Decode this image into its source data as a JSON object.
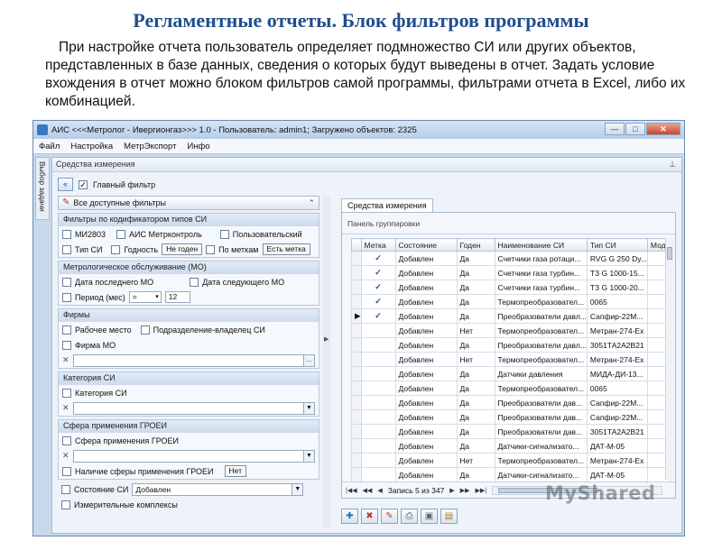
{
  "slide": {
    "title": "Регламентные отчеты. Блок фильтров программы",
    "paragraph": "При настройке отчета пользователь определяет подмножество СИ или других объектов, представленных в базе данных, сведения о которых будут выведены в отчет. Задать условие вхождения в отчет можно блоком фильтров самой программы, фильтрами отчета в Excel, либо их комбинацией."
  },
  "window": {
    "title": "АИС <<<Метролог - Ивергионгаз>>> 1.0 - Пользователь: admin1; Загружено объектов: 2325",
    "controls": {
      "minimize": "—",
      "maximize": "□",
      "close": "✕"
    }
  },
  "menu": [
    "Файл",
    "Настройка",
    "МетрЭкспорт",
    "Инфо"
  ],
  "side_tab": "Выбор задачи",
  "panel": {
    "header": "Средства измерения",
    "pin": "⊥"
  },
  "toolbar": {
    "main_filter_label": "Главный фильтр",
    "main_filter_checked": "✓"
  },
  "filters": {
    "all_label": "Все доступные фильтры",
    "codifier": {
      "header": "Фильтры по кодификатором типов СИ",
      "opt1": "МИ2803",
      "opt2": "АИС Метрконтроль",
      "opt3": "Пользовательский",
      "opt4": "Тип СИ",
      "opt5": "Годность",
      "btn_bad": "Не годен",
      "opt6": "По меткам",
      "btn_mark": "Есть метка"
    },
    "maintenance": {
      "header": "Метрологическое обслуживание (МО)",
      "last": "Дата последнего МО",
      "next": "Дата следующего МО",
      "period": "Период (мес)",
      "op": "=",
      "period_value": "12"
    },
    "firms": {
      "header": "Фирмы",
      "workplace": "Рабочее место",
      "division": "Подразделение-владелец СИ",
      "firm": "Фирма МО",
      "clear": "✕",
      "more": "..."
    },
    "category": {
      "header": "Категория СИ",
      "label": "Категория СИ",
      "clear": "✕"
    },
    "sphere": {
      "header": "Сфера применения ГРОЕИ",
      "label": "Сфера применения ГРОЕИ",
      "clear": "✕",
      "presence": "Наличие сферы применения ГРОЕИ",
      "presence_value": "Нет"
    },
    "state": {
      "label": "Состояние СИ",
      "value": "Добавлен"
    },
    "complex": {
      "label": "Измерительные комплексы"
    }
  },
  "grid": {
    "tab": "Средства измерения",
    "group_panel": "Панель группировки",
    "columns": [
      "Метка",
      "Состояние",
      "Годен",
      "Наименование СИ",
      "Тип СИ",
      "Моде"
    ],
    "rows": [
      {
        "m": "✓",
        "s": "Добавлен",
        "g": "Да",
        "n": "Счетчики газа ротаци...",
        "t": "RVG G 250 Dy..."
      },
      {
        "m": "✓",
        "s": "Добавлен",
        "g": "Да",
        "n": "Счетчики газа турбин...",
        "t": "ТЗ G 1000-15..."
      },
      {
        "m": "✓",
        "s": "Добавлен",
        "g": "Да",
        "n": "Счетчики газа турбин...",
        "t": "ТЗ G 1000-20..."
      },
      {
        "m": "✓",
        "s": "Добавлен",
        "g": "Да",
        "n": "Термопреобразовател...",
        "t": "0065"
      },
      {
        "m": "✓",
        "s": "Добавлен",
        "g": "Да",
        "n": "Преобразователи давл...",
        "t": "Сапфир-22М..."
      },
      {
        "m": "",
        "s": "Добавлен",
        "g": "Нет",
        "n": "Термопреобразовател...",
        "t": "Метран-274-Ex"
      },
      {
        "m": "",
        "s": "Добавлен",
        "g": "Да",
        "n": "Преобразователи давл...",
        "t": "3051ТА2А2В21"
      },
      {
        "m": "",
        "s": "Добавлен",
        "g": "Нет",
        "n": "Термопреобразовател...",
        "t": "Метран-274-Ex"
      },
      {
        "m": "",
        "s": "Добавлен",
        "g": "Да",
        "n": "Датчики давления",
        "t": "МИДА-ДИ-13..."
      },
      {
        "m": "",
        "s": "Добавлен",
        "g": "Да",
        "n": "Термопреобразовател...",
        "t": "0065"
      },
      {
        "m": "",
        "s": "Добавлен",
        "g": "Да",
        "n": "Преобразователи дав...",
        "t": "Сапфир-22М..."
      },
      {
        "m": "",
        "s": "Добавлен",
        "g": "Да",
        "n": "Преобразователи дав...",
        "t": "Сапфир-22М..."
      },
      {
        "m": "",
        "s": "Добавлен",
        "g": "Да",
        "n": "Преобразователи дав...",
        "t": "3051ТА2А2В21"
      },
      {
        "m": "",
        "s": "Добавлен",
        "g": "Да",
        "n": "Датчики-сигнализато...",
        "t": "ДАТ-М-05"
      },
      {
        "m": "",
        "s": "Добавлен",
        "g": "Нет",
        "n": "Термопреобразовател...",
        "t": "Метран-274-Ex"
      },
      {
        "m": "",
        "s": "Добавлен",
        "g": "Да",
        "n": "Датчики-сигнализато...",
        "t": "ДАТ-М-05"
      }
    ],
    "record_text": "Запись 5 из 347"
  },
  "watermark": "MyShared"
}
